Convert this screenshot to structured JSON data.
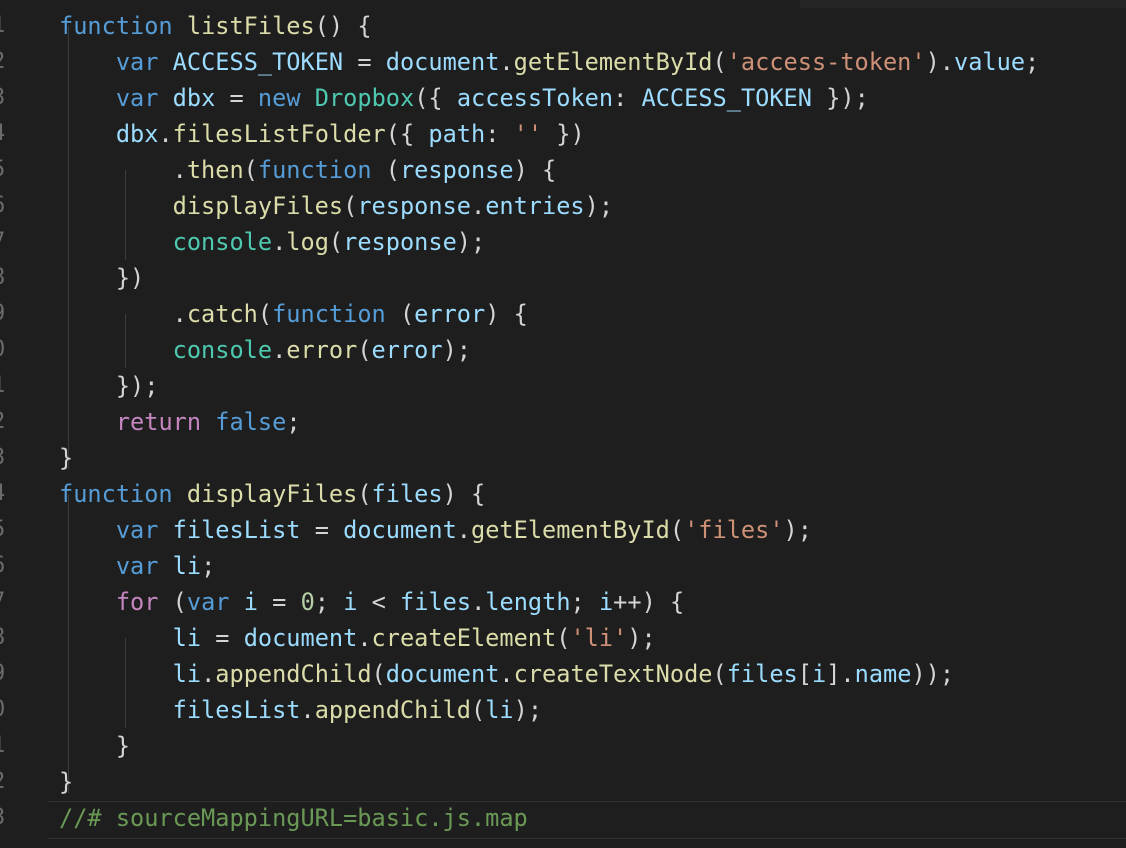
{
  "gutter": {
    "line_numbers": [
      "1",
      "2",
      "3",
      "4",
      "5",
      "6",
      "7",
      "8",
      "9",
      "0",
      "1",
      "2",
      "3",
      "4",
      "5",
      "6",
      "7",
      "8",
      "9",
      "0",
      "1",
      "2",
      "3"
    ]
  },
  "lines": [
    [
      [
        "kw",
        "function"
      ],
      [
        "pn",
        " "
      ],
      [
        "fn",
        "listFiles"
      ],
      [
        "pn",
        "() {"
      ]
    ],
    [
      [
        "pn",
        "    "
      ],
      [
        "kw",
        "var"
      ],
      [
        "pn",
        " "
      ],
      [
        "vr",
        "ACCESS_TOKEN"
      ],
      [
        "pn",
        " = "
      ],
      [
        "vr",
        "document"
      ],
      [
        "pn",
        "."
      ],
      [
        "fn",
        "getElementById"
      ],
      [
        "pn",
        "("
      ],
      [
        "str",
        "'access-token'"
      ],
      [
        "pn",
        ")."
      ],
      [
        "vr",
        "value"
      ],
      [
        "pn",
        ";"
      ]
    ],
    [
      [
        "pn",
        "    "
      ],
      [
        "kw",
        "var"
      ],
      [
        "pn",
        " "
      ],
      [
        "vr",
        "dbx"
      ],
      [
        "pn",
        " = "
      ],
      [
        "kw",
        "new"
      ],
      [
        "pn",
        " "
      ],
      [
        "cls",
        "Dropbox"
      ],
      [
        "pn",
        "({ "
      ],
      [
        "vr",
        "accessToken"
      ],
      [
        "pn",
        ": "
      ],
      [
        "vr",
        "ACCESS_TOKEN"
      ],
      [
        "pn",
        " });"
      ]
    ],
    [
      [
        "pn",
        "    "
      ],
      [
        "vr",
        "dbx"
      ],
      [
        "pn",
        "."
      ],
      [
        "fn",
        "filesListFolder"
      ],
      [
        "pn",
        "({ "
      ],
      [
        "vr",
        "path"
      ],
      [
        "pn",
        ": "
      ],
      [
        "str",
        "''"
      ],
      [
        "pn",
        " })"
      ]
    ],
    [
      [
        "pn",
        "        ."
      ],
      [
        "fn",
        "then"
      ],
      [
        "pn",
        "("
      ],
      [
        "kw",
        "function"
      ],
      [
        "pn",
        " ("
      ],
      [
        "vr",
        "response"
      ],
      [
        "pn",
        ") {"
      ]
    ],
    [
      [
        "pn",
        "        "
      ],
      [
        "fn",
        "displayFiles"
      ],
      [
        "pn",
        "("
      ],
      [
        "vr",
        "response"
      ],
      [
        "pn",
        "."
      ],
      [
        "vr",
        "entries"
      ],
      [
        "pn",
        ");"
      ]
    ],
    [
      [
        "pn",
        "        "
      ],
      [
        "cls",
        "console"
      ],
      [
        "pn",
        "."
      ],
      [
        "fn",
        "log"
      ],
      [
        "pn",
        "("
      ],
      [
        "vr",
        "response"
      ],
      [
        "pn",
        ");"
      ]
    ],
    [
      [
        "pn",
        "    })"
      ]
    ],
    [
      [
        "pn",
        "        ."
      ],
      [
        "fn",
        "catch"
      ],
      [
        "pn",
        "("
      ],
      [
        "kw",
        "function"
      ],
      [
        "pn",
        " ("
      ],
      [
        "vr",
        "error"
      ],
      [
        "pn",
        ") {"
      ]
    ],
    [
      [
        "pn",
        "        "
      ],
      [
        "cls",
        "console"
      ],
      [
        "pn",
        "."
      ],
      [
        "fn",
        "error"
      ],
      [
        "pn",
        "("
      ],
      [
        "vr",
        "error"
      ],
      [
        "pn",
        ");"
      ]
    ],
    [
      [
        "pn",
        "    });"
      ]
    ],
    [
      [
        "pn",
        "    "
      ],
      [
        "ctl",
        "return"
      ],
      [
        "pn",
        " "
      ],
      [
        "kw",
        "false"
      ],
      [
        "pn",
        ";"
      ]
    ],
    [
      [
        "pn",
        "}"
      ]
    ],
    [
      [
        "kw",
        "function"
      ],
      [
        "pn",
        " "
      ],
      [
        "fn",
        "displayFiles"
      ],
      [
        "pn",
        "("
      ],
      [
        "vr",
        "files"
      ],
      [
        "pn",
        ") {"
      ]
    ],
    [
      [
        "pn",
        "    "
      ],
      [
        "kw",
        "var"
      ],
      [
        "pn",
        " "
      ],
      [
        "vr",
        "filesList"
      ],
      [
        "pn",
        " = "
      ],
      [
        "vr",
        "document"
      ],
      [
        "pn",
        "."
      ],
      [
        "fn",
        "getElementById"
      ],
      [
        "pn",
        "("
      ],
      [
        "str",
        "'files'"
      ],
      [
        "pn",
        ");"
      ]
    ],
    [
      [
        "pn",
        "    "
      ],
      [
        "kw",
        "var"
      ],
      [
        "pn",
        " "
      ],
      [
        "vr",
        "li"
      ],
      [
        "pn",
        ";"
      ]
    ],
    [
      [
        "pn",
        "    "
      ],
      [
        "ctl",
        "for"
      ],
      [
        "pn",
        " ("
      ],
      [
        "kw",
        "var"
      ],
      [
        "pn",
        " "
      ],
      [
        "vr",
        "i"
      ],
      [
        "pn",
        " = "
      ],
      [
        "num",
        "0"
      ],
      [
        "pn",
        "; "
      ],
      [
        "vr",
        "i"
      ],
      [
        "pn",
        " < "
      ],
      [
        "vr",
        "files"
      ],
      [
        "pn",
        "."
      ],
      [
        "vr",
        "length"
      ],
      [
        "pn",
        "; "
      ],
      [
        "vr",
        "i"
      ],
      [
        "pn",
        "++) {"
      ]
    ],
    [
      [
        "pn",
        "        "
      ],
      [
        "vr",
        "li"
      ],
      [
        "pn",
        " = "
      ],
      [
        "vr",
        "document"
      ],
      [
        "pn",
        "."
      ],
      [
        "fn",
        "createElement"
      ],
      [
        "pn",
        "("
      ],
      [
        "str",
        "'li'"
      ],
      [
        "pn",
        ");"
      ]
    ],
    [
      [
        "pn",
        "        "
      ],
      [
        "vr",
        "li"
      ],
      [
        "pn",
        "."
      ],
      [
        "fn",
        "appendChild"
      ],
      [
        "pn",
        "("
      ],
      [
        "vr",
        "document"
      ],
      [
        "pn",
        "."
      ],
      [
        "fn",
        "createTextNode"
      ],
      [
        "pn",
        "("
      ],
      [
        "vr",
        "files"
      ],
      [
        "pn",
        "["
      ],
      [
        "vr",
        "i"
      ],
      [
        "pn",
        "]."
      ],
      [
        "vr",
        "name"
      ],
      [
        "pn",
        "));"
      ]
    ],
    [
      [
        "pn",
        "        "
      ],
      [
        "vr",
        "filesList"
      ],
      [
        "pn",
        "."
      ],
      [
        "fn",
        "appendChild"
      ],
      [
        "pn",
        "("
      ],
      [
        "vr",
        "li"
      ],
      [
        "pn",
        ");"
      ]
    ],
    [
      [
        "pn",
        "    }"
      ]
    ],
    [
      [
        "pn",
        "}"
      ]
    ],
    [
      [
        "cmt",
        "//# sourceMappingURL=basic.js.map"
      ]
    ]
  ]
}
